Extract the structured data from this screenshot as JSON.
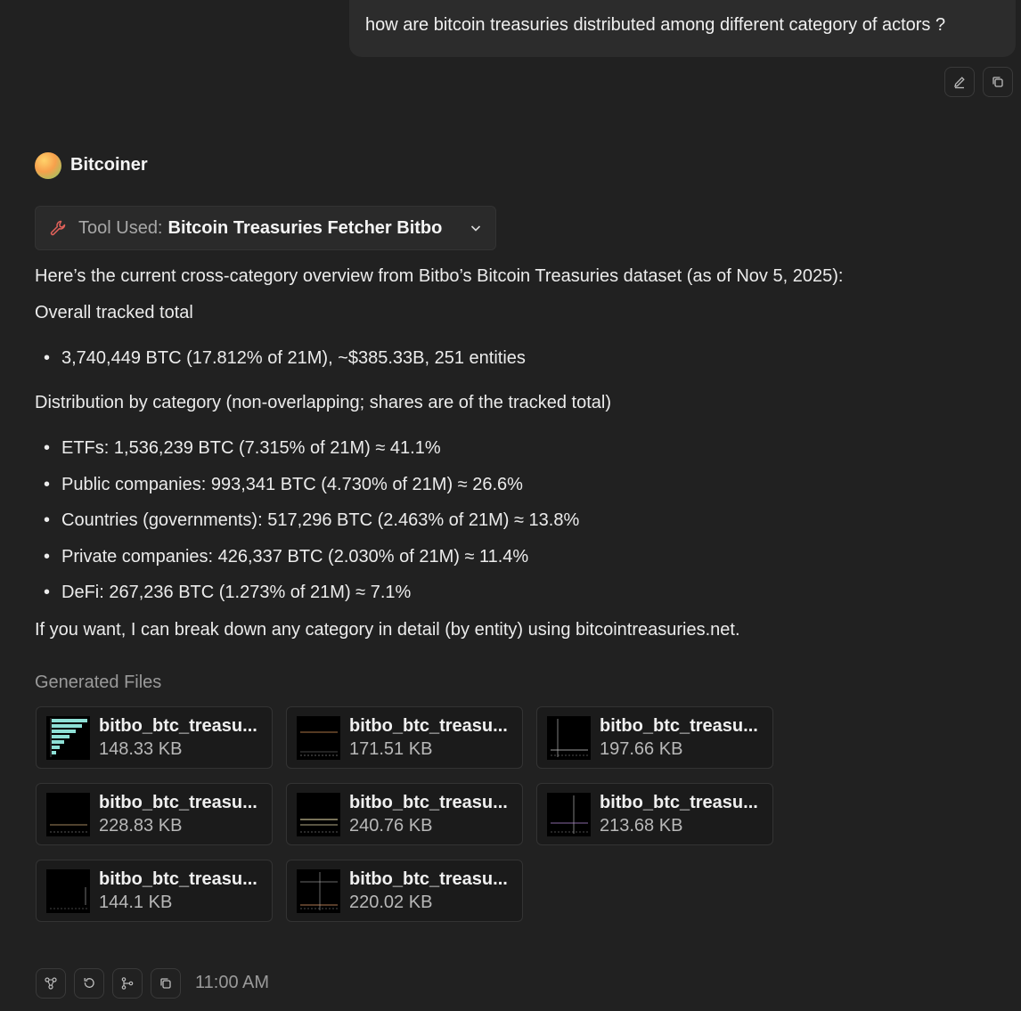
{
  "user_message": "how are bitcoin treasuries distributed among different category of actors ?",
  "user_actions": [
    {
      "icon": "edit-icon"
    },
    {
      "icon": "copy-icon"
    }
  ],
  "assistant": {
    "name": "Bitcoiner",
    "avatar_colors": [
      "#ffd36b",
      "#f7a04c",
      "#86d067"
    ]
  },
  "tool": {
    "label": "Tool Used:",
    "name": "Bitcoin Treasuries Fetcher Bitbo",
    "icon": "wrench-icon",
    "accent": "#e0615a"
  },
  "response": {
    "intro": "Here’s the current cross-category overview from Bitbo’s Bitcoin Treasuries dataset (as of Nov 5, 2025):",
    "overall_heading": "Overall tracked total",
    "overall_items": [
      "3,740,449 BTC (17.812% of 21M), ~$385.33B, 251 entities"
    ],
    "distribution_heading": "Distribution by category (non-overlapping; shares are of the tracked total)",
    "distribution_items": [
      "ETFs: 1,536,239 BTC (7.315% of 21M) ≈ 41.1%",
      "Public companies: 993,341 BTC (4.730% of 21M) ≈ 26.6%",
      "Countries (governments): 517,296 BTC (2.463% of 21M) ≈ 13.8%",
      "Private companies: 426,337 BTC (2.030% of 21M) ≈ 11.4%",
      "DeFi: 267,236 BTC (1.273% of 21M) ≈ 7.1%"
    ],
    "closing": "If you want, I can break down any category in detail (by entity) using bitcointreasuries.net."
  },
  "generated_files": {
    "title": "Generated Files",
    "files": [
      {
        "name": "bitbo_btc_treasu...",
        "size": "148.33 KB"
      },
      {
        "name": "bitbo_btc_treasu...",
        "size": "171.51 KB"
      },
      {
        "name": "bitbo_btc_treasu...",
        "size": "197.66 KB"
      },
      {
        "name": "bitbo_btc_treasu...",
        "size": "228.83 KB"
      },
      {
        "name": "bitbo_btc_treasu...",
        "size": "240.76 KB"
      },
      {
        "name": "bitbo_btc_treasu...",
        "size": "213.68 KB"
      },
      {
        "name": "bitbo_btc_treasu...",
        "size": "144.1 KB"
      },
      {
        "name": "bitbo_btc_treasu...",
        "size": "220.02 KB"
      }
    ]
  },
  "message_actions": [
    {
      "icon": "share-nodes-icon"
    },
    {
      "icon": "regenerate-icon"
    },
    {
      "icon": "branch-icon"
    },
    {
      "icon": "copy-icon"
    }
  ],
  "timestamp": "11:00 AM"
}
